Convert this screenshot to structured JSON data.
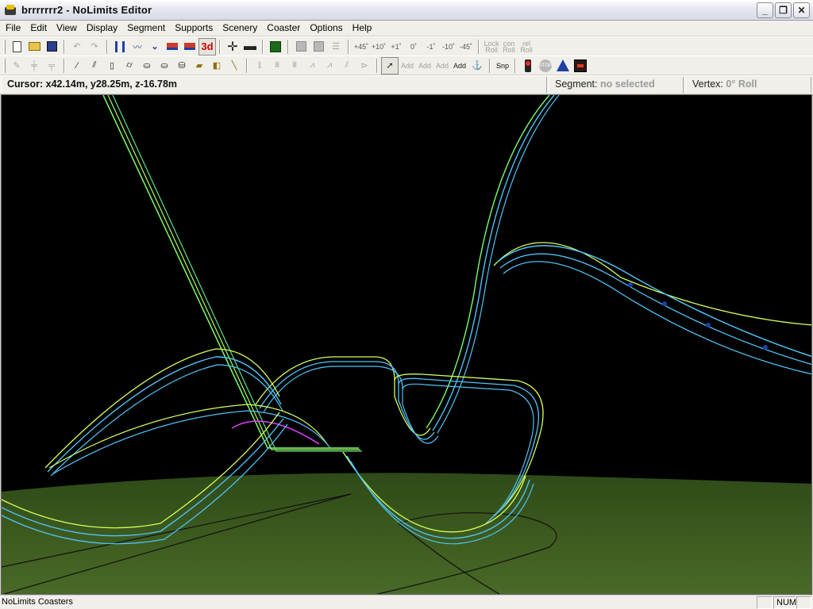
{
  "window": {
    "title": "brrrrrrr2 - NoLimits Editor",
    "minimize": "_",
    "maximize": "❐",
    "close": "✕"
  },
  "menu": [
    "File",
    "Edit",
    "View",
    "Display",
    "Segment",
    "Supports",
    "Scenery",
    "Coaster",
    "Options",
    "Help"
  ],
  "toolbar": {
    "three_d": "3d",
    "roll_labels": [
      "+45˚",
      "+10˚",
      "+1˚",
      "0˚",
      "-1˚",
      "-10˚",
      "-45˚"
    ],
    "lock_roll": "Lock\nRoll",
    "con_roll": "con\nRoll",
    "rel_roll": "rel\nRoll",
    "add1": "Add",
    "add2": "Add",
    "add3": "Add",
    "add4": "Add",
    "snp": "Snp",
    "stop": "STOP"
  },
  "info": {
    "cursor": "Cursor: x42.14m, y28.25m, z-16.78m",
    "segment_label": "Segment:",
    "segment_value": "no selected",
    "vertex_label": "Vertex:",
    "vertex_value": "0° Roll"
  },
  "viewport": {
    "background": "#000000",
    "ground_color": "#3c5a1e",
    "track_colors": [
      "#4fc3f7",
      "#d8ff5a",
      "#7cfc6a",
      "#e040fb"
    ]
  },
  "status": {
    "text": "NoLimits Coasters",
    "num": "NUM"
  }
}
